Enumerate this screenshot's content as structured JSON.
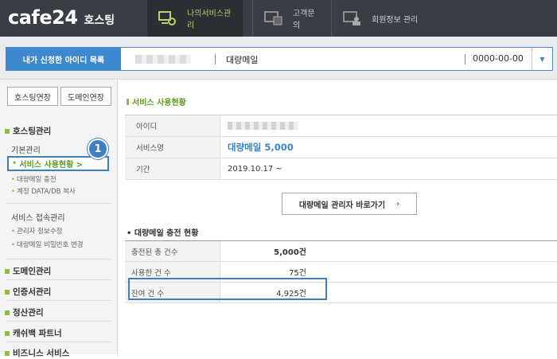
{
  "header": {
    "logo_text": "cafe24",
    "logo_sub": "호스팅",
    "nav": [
      {
        "label": "나의서비스관리",
        "icon": "service-manage-icon"
      },
      {
        "label": "고객문의",
        "icon": "customer-inquiry-icon"
      },
      {
        "label": "회원정보 관리",
        "icon": "member-info-icon"
      }
    ]
  },
  "id_bar": {
    "label": "내가 신청한 아이디 목록",
    "service": "대량메일",
    "date": "0000-00-00"
  },
  "sidebar": {
    "buttons": {
      "hosting_extend": "호스팅연장",
      "domain_extend": "도메인연장"
    },
    "section_hosting": "호스팅관리",
    "basic_mgmt": "기본관리",
    "active_item": "서비스 사용현황 >",
    "items_basic": [
      "대량메일 충전",
      "계정 DATA/DB 복사"
    ],
    "service_access": "서비스 접속관리",
    "items_access": [
      "관리자 정보수정",
      "대량메일 비밀번호 변경"
    ],
    "sections": [
      "도메인관리",
      "인증서관리",
      "정산관리",
      "캐쉬백 파트너",
      "비즈니스 서비스"
    ],
    "step_badge": "1"
  },
  "main": {
    "usage_title": "서비스 사용현황",
    "table": {
      "id_label": "아이디",
      "service_label": "서비스명",
      "service_value": "대량메일 5,000",
      "period_label": "기간",
      "period_value": "2019.10.17 ~"
    },
    "goto_button": "대량메일 관리자 바로가기",
    "charge_title": "• 대량메일 충전 현황",
    "counts": [
      {
        "label": "충전된 총 건수",
        "value": "5,000건"
      },
      {
        "label": "사용한 건 수",
        "value": "75건"
      },
      {
        "label": "잔여 건 수",
        "value": "4,925건"
      }
    ]
  }
}
